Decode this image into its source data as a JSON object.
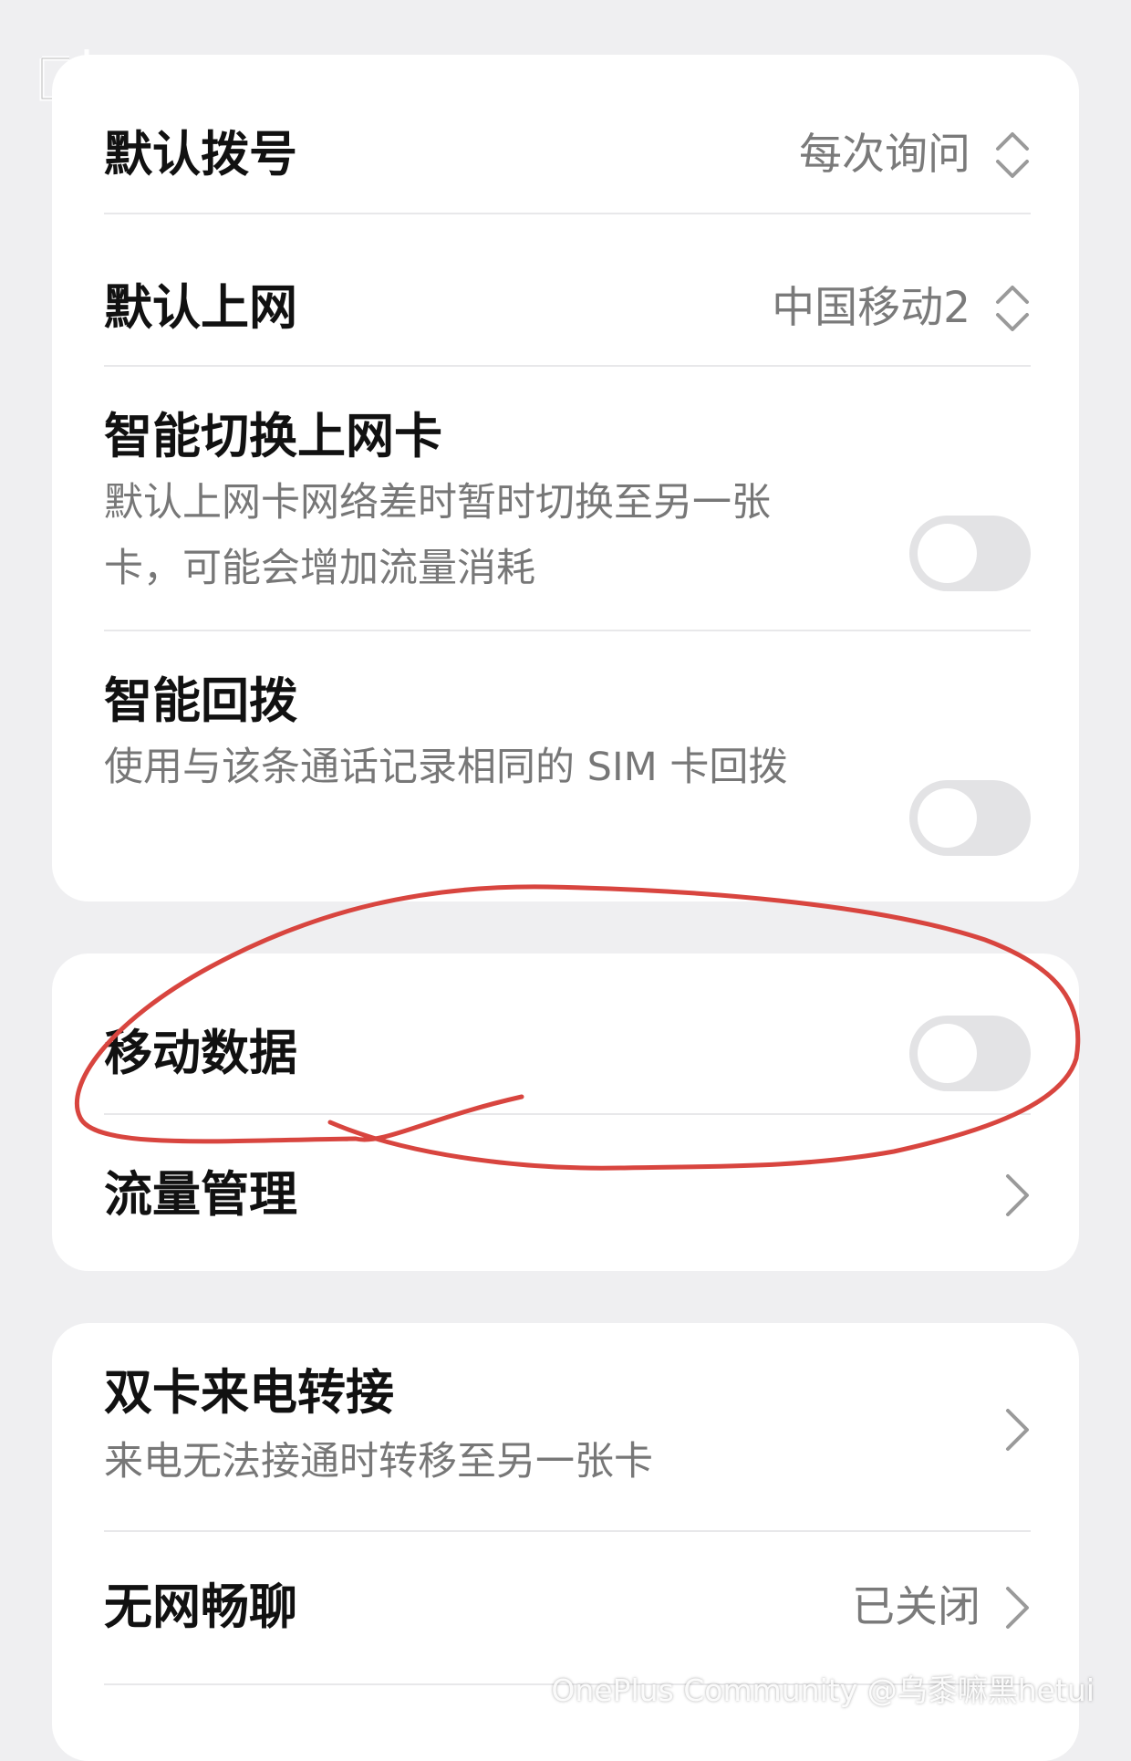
{
  "sim_settings": {
    "default_dial": {
      "label": "默认拨号",
      "value": "每次询问"
    },
    "default_data": {
      "label": "默认上网",
      "value": "中国移动2"
    },
    "smart_switch": {
      "label": "智能切换上网卡",
      "description": "默认上网卡网络差时暂时切换至另一张卡，可能会增加流量消耗",
      "enabled": false
    },
    "smart_callback": {
      "label": "智能回拨",
      "description": "使用与该条通话记录相同的 SIM 卡回拨",
      "enabled": false
    }
  },
  "data_settings": {
    "mobile_data": {
      "label": "移动数据",
      "enabled": false
    },
    "data_management": {
      "label": "流量管理"
    }
  },
  "call_settings": {
    "call_forwarding": {
      "label": "双卡来电转接",
      "description": "来电无法接通时转移至另一张卡"
    },
    "offline_chat": {
      "label": "无网畅聊",
      "value": "已关闭"
    }
  },
  "watermark": "OnePlus Community @乌黍嘛黑hetui",
  "colors": {
    "background": "#efeff1",
    "card": "#ffffff",
    "toggle_off": "#e3e3e5",
    "annotation": "#d8453f"
  }
}
